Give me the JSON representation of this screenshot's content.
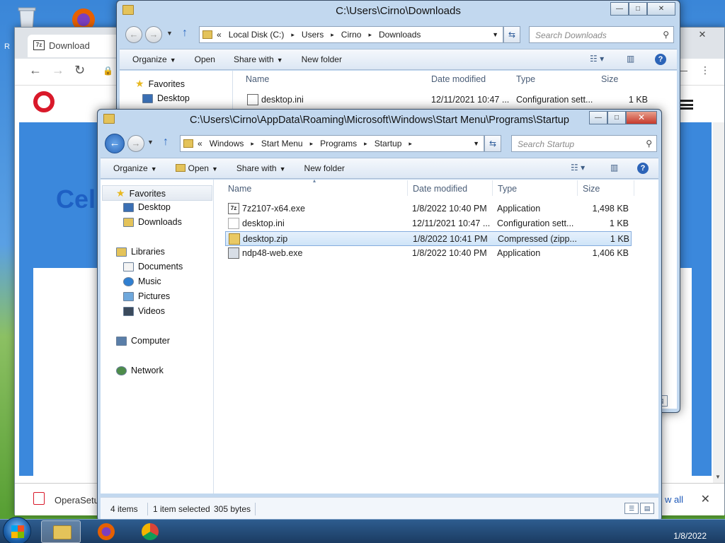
{
  "desktop": {
    "edge_letter": "R"
  },
  "browser": {
    "tab_title": "Download",
    "tab_icon_text": "7z",
    "hero_text": "Cel",
    "download_filename": "OperaSetu",
    "show_all_label": "w all"
  },
  "explorer_back": {
    "title": "C:\\Users\\Cirno\\Downloads",
    "breadcrumb": [
      "«",
      "Local Disk (C:)",
      "Users",
      "Cirno",
      "Downloads"
    ],
    "search_placeholder": "Search Downloads",
    "toolbar": {
      "organize": "Organize",
      "open": "Open",
      "share_with": "Share with",
      "new_folder": "New folder"
    },
    "nav": {
      "favorites": "Favorites",
      "desktop": "Desktop"
    },
    "columns": {
      "name": "Name",
      "date_modified": "Date modified",
      "type": "Type",
      "size": "Size"
    },
    "files": [
      {
        "name": "desktop.ini",
        "date": "12/11/2021 10:47 ...",
        "type": "Configuration sett...",
        "size": "1 KB"
      }
    ]
  },
  "explorer_front": {
    "title": "C:\\Users\\Cirno\\AppData\\Roaming\\Microsoft\\Windows\\Start Menu\\Programs\\Startup",
    "breadcrumb": [
      "«",
      "Windows",
      "Start Menu",
      "Programs",
      "Startup"
    ],
    "search_placeholder": "Search Startup",
    "toolbar": {
      "organize": "Organize",
      "open": "Open",
      "share_with": "Share with",
      "new_folder": "New folder"
    },
    "nav": {
      "favorites": "Favorites",
      "desktop": "Desktop",
      "downloads": "Downloads",
      "libraries": "Libraries",
      "documents": "Documents",
      "music": "Music",
      "pictures": "Pictures",
      "videos": "Videos",
      "computer": "Computer",
      "network": "Network"
    },
    "columns": {
      "name": "Name",
      "date_modified": "Date modified",
      "type": "Type",
      "size": "Size"
    },
    "files": [
      {
        "name": "7z2107-x64.exe",
        "icon_text": "7z",
        "date": "1/8/2022 10:40 PM",
        "type": "Application",
        "size": "1,498 KB"
      },
      {
        "name": "desktop.ini",
        "icon_text": "",
        "date": "12/11/2021 10:47 ...",
        "type": "Configuration sett...",
        "size": "1 KB"
      },
      {
        "name": "desktop.zip",
        "icon_text": "",
        "date": "1/8/2022 10:41 PM",
        "type": "Compressed (zipp...",
        "size": "1 KB"
      },
      {
        "name": "ndp48-web.exe",
        "icon_text": "",
        "date": "1/8/2022 10:40 PM",
        "type": "Application",
        "size": "1,406 KB"
      }
    ],
    "status": {
      "count": "4 items",
      "selected": "1 item selected",
      "bytes": "305 bytes"
    }
  },
  "taskbar": {
    "date": "1/8/2022"
  },
  "colors": {
    "accent": "#2c64b8",
    "selection": "#cfe4f8",
    "opera_red": "#d9192a"
  }
}
